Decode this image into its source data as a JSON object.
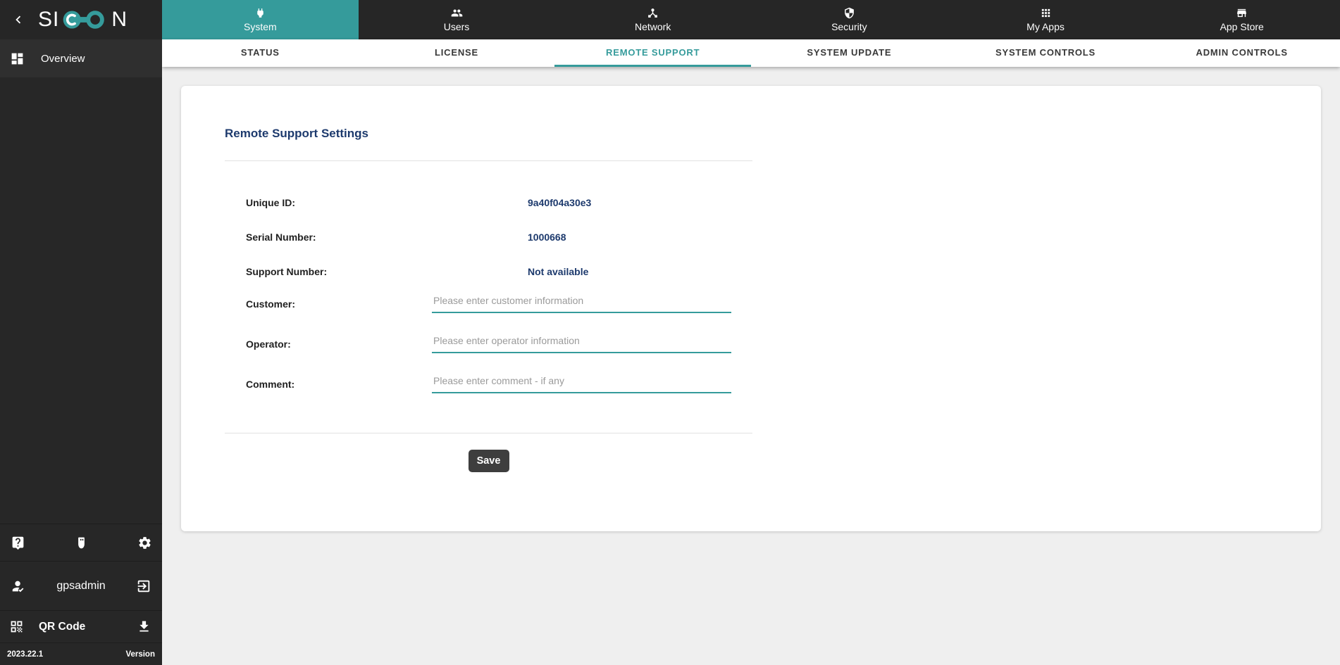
{
  "colors": {
    "accent": "#359b9b",
    "topbar_dark": "#262626",
    "navy_text": "#1d3a6d",
    "save_button_bg": "#3e3e3e",
    "page_bg": "#efefef"
  },
  "logo": {
    "full": "SICON",
    "prefix": "SI",
    "suffix": "N",
    "glyph": "link-circles-icon"
  },
  "sidebar": {
    "overview": {
      "label": "Overview",
      "icon": "dashboard-icon"
    },
    "tools": {
      "icons": [
        "help-icon",
        "usb-icon",
        "settings-gear-icon"
      ]
    },
    "account": {
      "username": "gpsadmin",
      "icon": "person-check-icon",
      "logout_icon": "logout-icon"
    },
    "qr": {
      "label": "QR Code",
      "icon": "qr-code-icon",
      "download_icon": "download-icon"
    },
    "version": {
      "value": "2023.22.1",
      "label": "Version"
    }
  },
  "topnav": {
    "tabs": [
      {
        "label": "System",
        "icon": "power-plug-icon",
        "active": true
      },
      {
        "label": "Users",
        "icon": "users-icon",
        "active": false
      },
      {
        "label": "Network",
        "icon": "network-hub-icon",
        "active": false
      },
      {
        "label": "Security",
        "icon": "shield-icon",
        "active": false
      },
      {
        "label": "My Apps",
        "icon": "apps-grid-icon",
        "active": false
      },
      {
        "label": "App Store",
        "icon": "store-icon",
        "active": false
      }
    ]
  },
  "subnav": {
    "tabs": [
      {
        "label": "STATUS",
        "active": false
      },
      {
        "label": "LICENSE",
        "active": false
      },
      {
        "label": "REMOTE SUPPORT",
        "active": true
      },
      {
        "label": "SYSTEM UPDATE",
        "active": false
      },
      {
        "label": "SYSTEM CONTROLS",
        "active": false
      },
      {
        "label": "ADMIN CONTROLS",
        "active": false
      }
    ]
  },
  "panel": {
    "title": "Remote Support Settings",
    "static_fields": [
      {
        "label": "Unique ID:",
        "value": "9a40f04a30e3"
      },
      {
        "label": "Serial Number:",
        "value": "1000668"
      },
      {
        "label": "Support Number:",
        "value": "Not available"
      }
    ],
    "inputs": [
      {
        "label": "Customer:",
        "placeholder": "Please enter customer information",
        "value": ""
      },
      {
        "label": "Operator:",
        "placeholder": "Please enter operator information",
        "value": ""
      },
      {
        "label": "Comment:",
        "placeholder": "Please enter comment - if any",
        "value": ""
      }
    ],
    "save_label": "Save"
  }
}
